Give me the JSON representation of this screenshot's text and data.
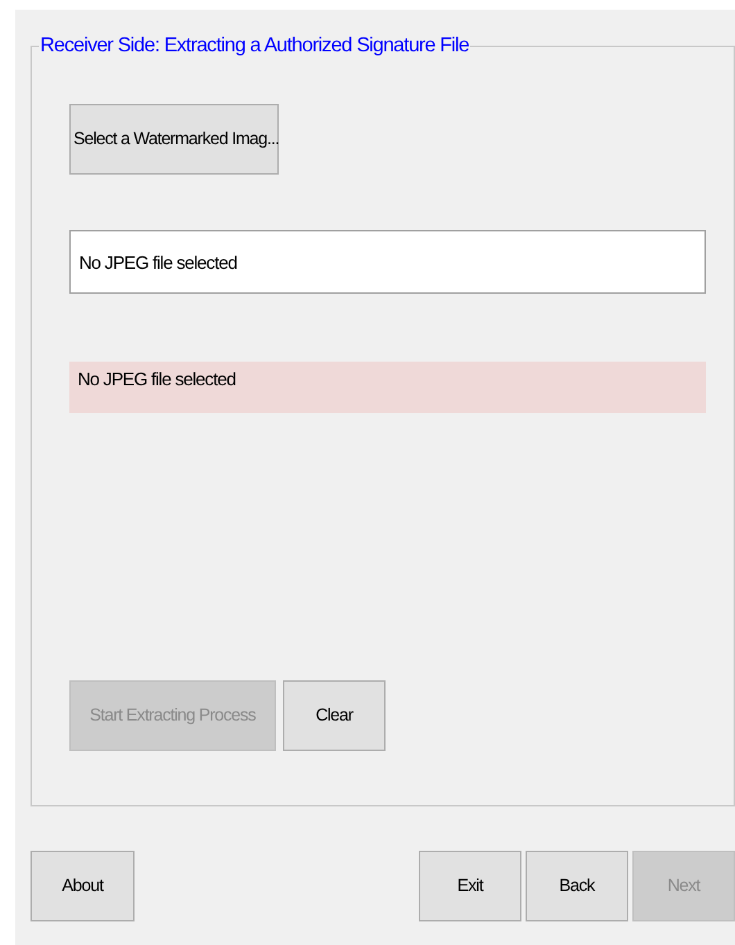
{
  "group": {
    "title": "Receiver Side: Extracting a Authorized Signature File"
  },
  "select_button": {
    "label": "Select a Watermarked Imag...",
    "disabled": false
  },
  "file_field": {
    "value": "No JPEG file selected"
  },
  "status_label": {
    "text": "No JPEG file selected"
  },
  "action_buttons": [
    {
      "label": "Start Extracting Process",
      "disabled": true
    },
    {
      "label": "Clear",
      "disabled": false
    }
  ],
  "about_button": {
    "label": "About",
    "disabled": false
  },
  "nav_buttons": [
    {
      "label": "Exit",
      "disabled": false
    },
    {
      "label": "Back",
      "disabled": false
    },
    {
      "label": "Next",
      "disabled": true
    }
  ]
}
